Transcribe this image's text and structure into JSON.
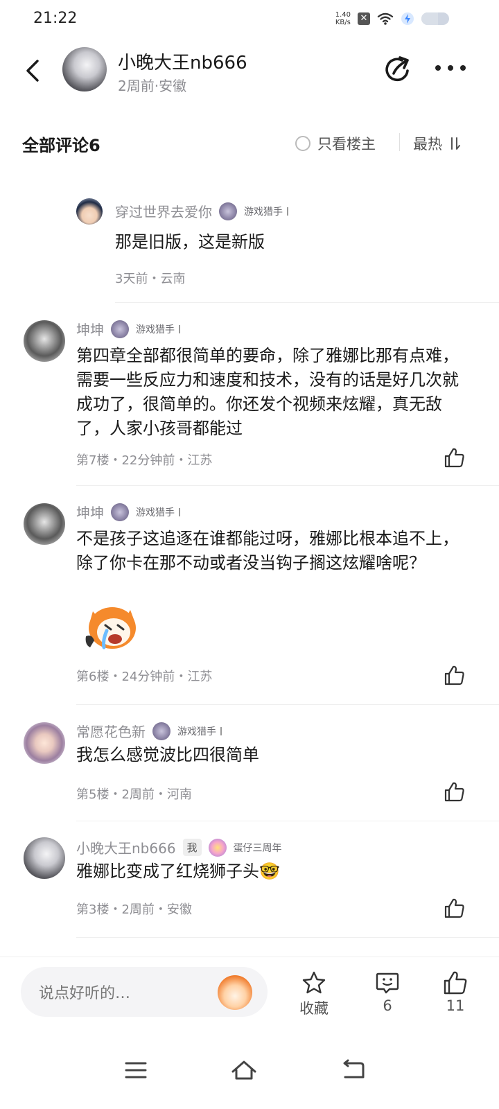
{
  "status_bar": {
    "time": "21:22",
    "speed_value": "1.40",
    "speed_unit": "KB/s"
  },
  "header": {
    "author_name": "小晚大王nb666",
    "meta": "2周前·安徽",
    "back_icon": "chevron-left-icon",
    "share_icon": "share-icon",
    "more_icon": "more-dots-icon"
  },
  "comments_bar": {
    "title": "全部评论6",
    "only_owner_label": "只看楼主",
    "sort_label": "最热",
    "sort_icon": "sort-icon"
  },
  "comments": [
    {
      "author": "穿过世界去爱你",
      "badge": "游戏猎手",
      "text": "那是旧版，这是新版",
      "meta": "3天前・云南",
      "is_reply": true
    },
    {
      "author": "坤坤",
      "badge": "游戏猎手",
      "text": "第四章全部都很简单的要命，除了雅娜比那有点难，需要一些反应力和速度和技术，没有的话是好几次就成功了，很简单的。你还发个视频来炫耀，真无敌了，人家小孩哥都能过",
      "meta": "第7楼・22分钟前・江苏"
    },
    {
      "author": "坤坤",
      "badge": "游戏猎手",
      "text": "不是孩子这追逐在谁都能过呀，雅娜比根本追不上，除了你卡在那不动或者没当钩子搁这炫耀啥呢？",
      "meta": "第6楼・24分钟前・江苏",
      "sticker": "crying-orange-fox-sticker"
    },
    {
      "author": "常愿花色新",
      "badge": "游戏猎手",
      "text": "我怎么感觉波比四很简单",
      "meta": "第5楼・2周前・河南"
    },
    {
      "author": "小晚大王nb666",
      "me_tag": "我",
      "badge": "蛋仔三周年",
      "text": "雅娜比变成了红烧狮子头🤓",
      "meta": "第3楼・2周前・安徽"
    }
  ],
  "bottom_bar": {
    "input_placeholder": "说点好听的…",
    "favorite_label": "收藏",
    "comment_count": "6",
    "like_count": "11",
    "favorite_icon": "star-icon",
    "comment_icon": "comment-icon",
    "like_icon": "thumbs-up-icon"
  },
  "nav_bar": {
    "menu_icon": "menu-icon",
    "home_icon": "home-icon",
    "back_icon": "back-arrow-icon"
  },
  "colors": {
    "text_primary": "#1a1a1a",
    "text_secondary": "#8e8e93",
    "divider": "#efefef",
    "input_bg": "#f4f4f6"
  }
}
